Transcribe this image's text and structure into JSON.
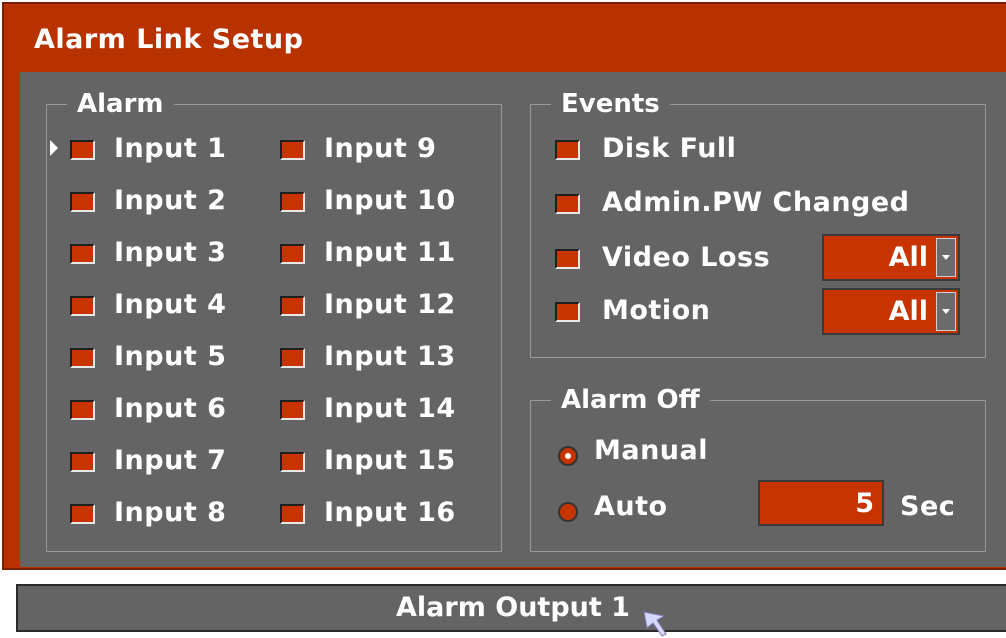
{
  "window": {
    "title": "Alarm Link Setup"
  },
  "alarm": {
    "legend": "Alarm",
    "inputs_col1": [
      "Input 1",
      "Input 2",
      "Input 3",
      "Input 4",
      "Input 5",
      "Input 6",
      "Input 7",
      "Input 8"
    ],
    "inputs_col2": [
      "Input 9",
      "Input 10",
      "Input 11",
      "Input 12",
      "Input 13",
      "Input 14",
      "Input 15",
      "Input 16"
    ]
  },
  "events": {
    "legend": "Events",
    "items": [
      "Disk Full",
      "Admin.PW Changed",
      "Video Loss",
      "Motion"
    ],
    "video_loss_select": "All",
    "motion_select": "All"
  },
  "alarm_off": {
    "legend": "Alarm Off",
    "manual_label": "Manual",
    "auto_label": "Auto",
    "selected": "Manual",
    "auto_value": "5",
    "unit": "Sec"
  },
  "footer": {
    "label": "Alarm Output 1"
  },
  "colors": {
    "accent": "#b83200",
    "panel": "#646464",
    "checkbox": "#c73400",
    "text": "#ffffff"
  },
  "icons": {
    "focus_cursor": "triangle-right-icon",
    "mouse": "mouse-pointer-icon"
  }
}
